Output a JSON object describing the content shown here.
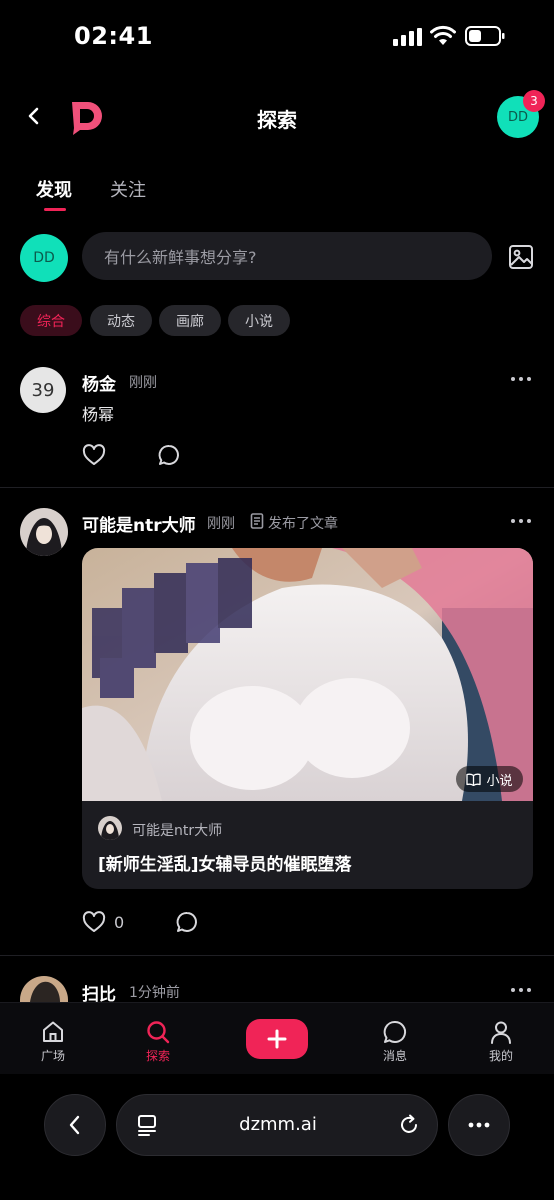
{
  "status_bar": {
    "time": "02:41"
  },
  "header": {
    "title": "探索",
    "avatar_initials": "DD",
    "notification_count": "3"
  },
  "tabs": [
    {
      "label": "发现"
    },
    {
      "label": "关注"
    }
  ],
  "composer": {
    "avatar_initials": "DD",
    "placeholder": "有什么新鲜事想分享?"
  },
  "filters": [
    {
      "label": "综合"
    },
    {
      "label": "动态"
    },
    {
      "label": "画廊"
    },
    {
      "label": "小说"
    }
  ],
  "posts": [
    {
      "avatar_text": "39",
      "author": "杨金",
      "time": "刚刚",
      "content": "杨幂"
    },
    {
      "author": "可能是ntr大师",
      "time": "刚刚",
      "action": "发布了文章",
      "article": {
        "tag": "小说",
        "author": "可能是ntr大师",
        "title": "[新师生淫乱]女辅导员的催眠堕落"
      },
      "like_count": "0"
    },
    {
      "author": "扫比",
      "time": "1分钟前"
    }
  ],
  "bottom_nav": [
    {
      "label": "广场",
      "icon": "home-icon"
    },
    {
      "label": "探索",
      "icon": "search-icon"
    },
    {
      "label": "消息",
      "icon": "chat-icon"
    },
    {
      "label": "我的",
      "icon": "user-icon"
    }
  ],
  "browser": {
    "url": "dzmm.ai"
  },
  "colors": {
    "accent": "#f02457",
    "avatar": "#10e0b9",
    "background": "#000000"
  }
}
